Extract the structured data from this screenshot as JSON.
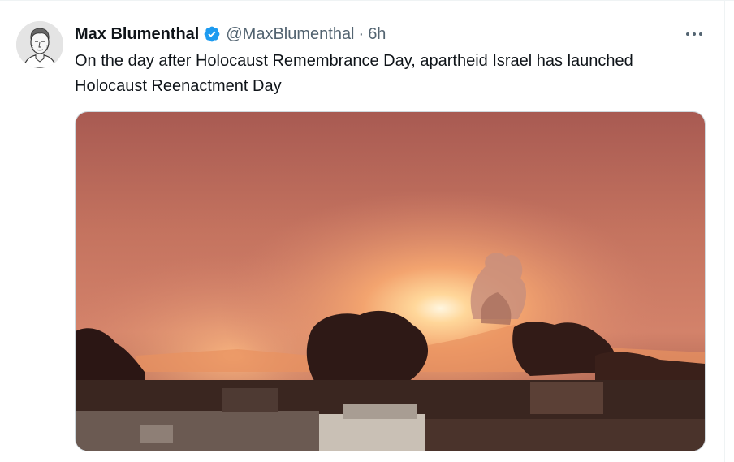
{
  "tweet": {
    "author_name": "Max Blumenthal",
    "handle": "@MaxBlumenthal",
    "separator": "·",
    "time": "6h",
    "text": "On the day after Holocaust Remembrance Day, apartheid Israel has launched Holocaust Reenactment Day",
    "verified": true
  },
  "icons": {
    "verified": "verified-badge-icon",
    "more": "more-options-icon",
    "avatar": "avatar"
  },
  "colors": {
    "name": "#0f1419",
    "secondary_text": "#536471",
    "verified_blue": "#1d9bf0",
    "media_border": "#cfd9de"
  }
}
